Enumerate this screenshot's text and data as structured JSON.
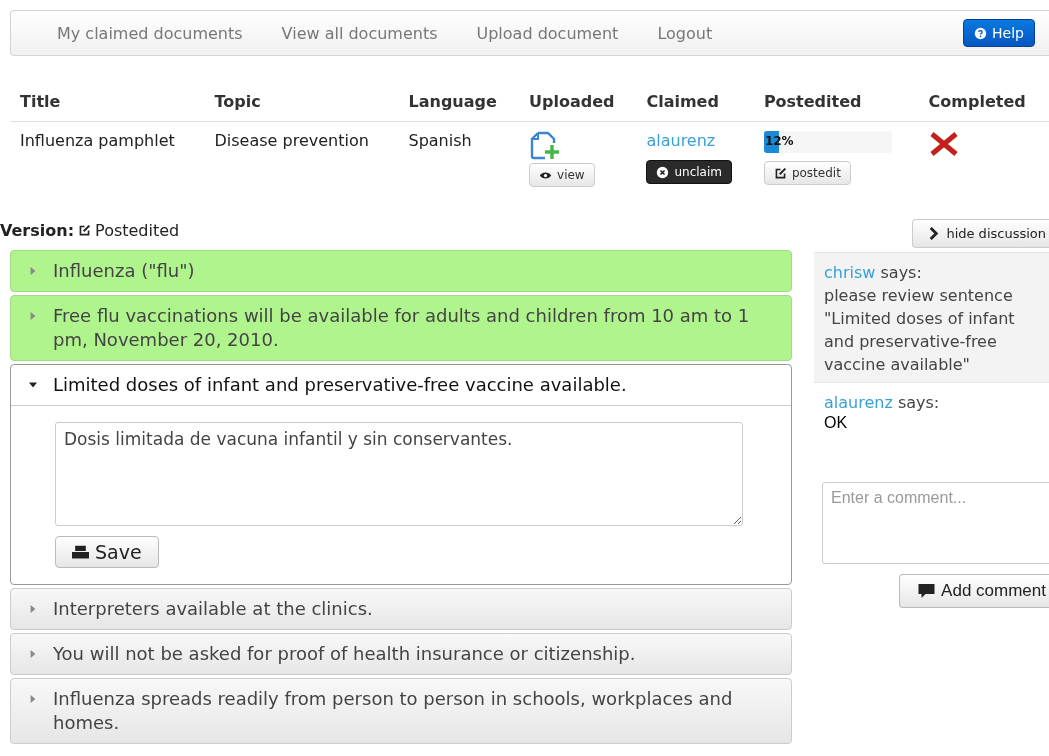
{
  "nav": {
    "items": [
      {
        "label": "My claimed documents"
      },
      {
        "label": "View all documents"
      },
      {
        "label": "Upload document"
      },
      {
        "label": "Logout"
      }
    ],
    "help_button": "Help"
  },
  "table": {
    "columns": [
      "Title",
      "Topic",
      "Language",
      "Uploaded",
      "Claimed",
      "Postedited",
      "Completed"
    ],
    "rows": [
      {
        "title": "Influenza pamphlet",
        "topic": "Disease prevention",
        "language": "Spanish",
        "view_button": "view",
        "claimed_by": "alaurenz",
        "unclaim_button": "unclaim",
        "progress": {
          "level": 0.12,
          "reading": "12%"
        },
        "postedit_button": "postedit",
        "completed": false
      }
    ]
  },
  "version": {
    "label": "Version:",
    "value": "Postedited"
  },
  "sentences": [
    {
      "text": "Influenza (\"flu\")",
      "approved": true,
      "expanded": false
    },
    {
      "text": "Free flu vaccinations will be available for adults and children from 10 am to 1 pm, November 20, 2010.",
      "approved": true,
      "expanded": false
    },
    {
      "text": "Limited doses of infant and preservative-free vaccine available.",
      "approved": false,
      "expanded": true,
      "translation": "Dosis limitada de vacuna infantil y sin conservantes.",
      "save_button": "Save"
    },
    {
      "text": "Interpreters available at the clinics.",
      "approved": false,
      "expanded": false
    },
    {
      "text": "You will not be asked for proof of health insurance or citizenship.",
      "approved": false,
      "expanded": false
    },
    {
      "text": "Influenza spreads readily from person to person in schools, workplaces and homes.",
      "approved": false,
      "expanded": false
    }
  ],
  "discussion": {
    "hide_button": "hide discussion",
    "comments": [
      {
        "author": "chrisw",
        "says": "says:",
        "text": "please review sentence \"Limited doses of infant and preservative-free vaccine available\"",
        "highlighted": true
      },
      {
        "author": "alaurenz",
        "says": "says:",
        "text": "OK",
        "highlighted": false
      }
    ],
    "comment_field": {
      "placeholder": "Enter a comment..."
    },
    "add_button": "Add comment"
  }
}
